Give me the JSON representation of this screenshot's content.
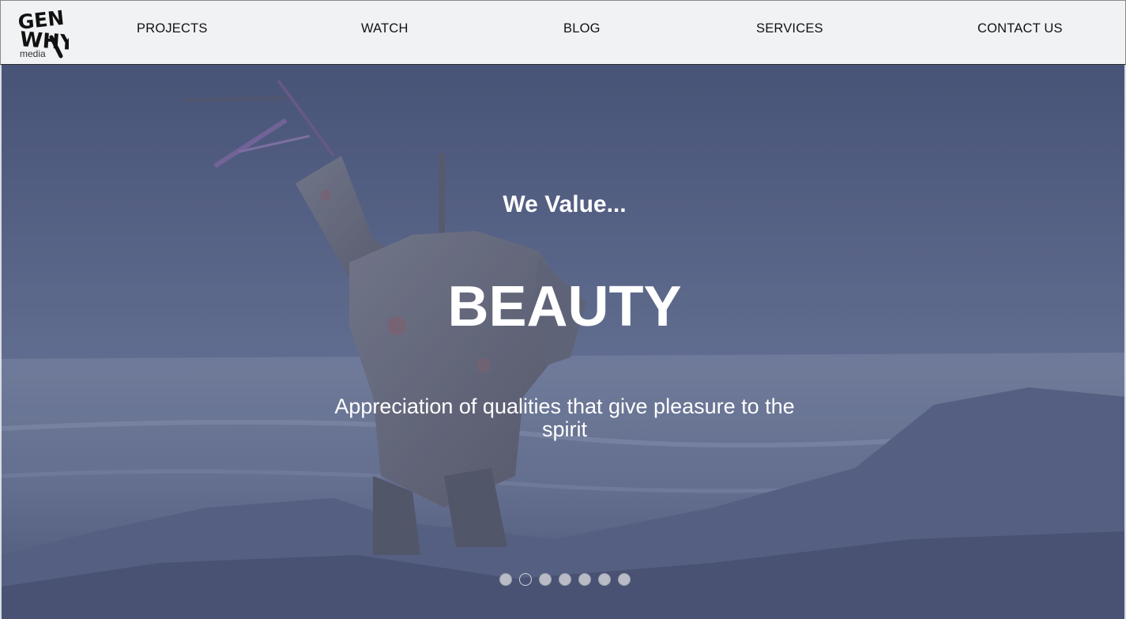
{
  "brand": {
    "logo_name": "gen-why-media-logo",
    "logo_lines": [
      "GEN",
      "WHY"
    ],
    "logo_sub": "media"
  },
  "nav": {
    "items": [
      {
        "label": "PROJECTS"
      },
      {
        "label": "WATCH"
      },
      {
        "label": "BLOG"
      },
      {
        "label": "SERVICES"
      },
      {
        "label": "CONTACT US"
      }
    ]
  },
  "hero": {
    "eyebrow": "We Value...",
    "title": "BEAUTY",
    "description": "Appreciation of qualities that give pleasure to the spirit",
    "slider": {
      "total": 7,
      "active_index": 1
    }
  },
  "colors": {
    "header_bg": "#f1f2f4",
    "overlay": "#3b4a70",
    "text_on_hero": "#ffffff"
  }
}
